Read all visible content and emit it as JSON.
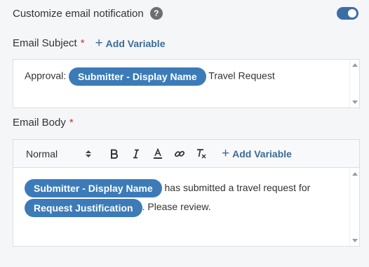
{
  "notification": {
    "toggle_label": "Customize email notification",
    "help_glyph": "?",
    "enabled": true
  },
  "subject": {
    "label": "Email Subject",
    "required_mark": "*",
    "add_variable_label": "Add Variable",
    "text_before": "Approval: ",
    "chip": "Submitter - Display Name",
    "text_after": " Travel Request"
  },
  "body": {
    "label": "Email Body",
    "required_mark": "*",
    "format_select": "Normal",
    "add_variable_label": "Add Variable",
    "chip1": "Submitter - Display Name",
    "text1": " has submitted a travel request for",
    "chip2": "Request Justification",
    "text2": ". Please review."
  },
  "colors": {
    "accent": "#3c7bb8",
    "link": "#3d6b96",
    "required": "#c0392b"
  },
  "icons": {
    "bold": "bold-icon",
    "italic": "italic-icon",
    "text_color": "text-color-icon",
    "link": "link-icon",
    "clear_format": "clear-format-icon",
    "plus": "plus-icon"
  }
}
